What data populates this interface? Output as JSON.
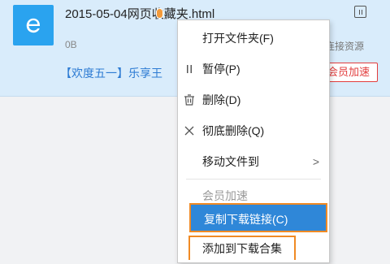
{
  "download": {
    "file_name": "2015-05-04网页收藏夹.html",
    "size": "0B",
    "connect_label": "连接资源",
    "promo_text": "【欢度五一】乐享王",
    "vip_button": "会员加速",
    "icon": "ie-e-icon",
    "accent_color": "#2aa3ef"
  },
  "menu": {
    "items": [
      {
        "label": "打开文件夹(F)",
        "icon": ""
      },
      {
        "label": "暂停(P)",
        "icon": "pause-icon"
      },
      {
        "label": "删除(D)",
        "icon": "trash-icon"
      },
      {
        "label": "彻底删除(Q)",
        "icon": "close-icon"
      },
      {
        "label": "移动文件到",
        "icon": "",
        "arrow": ">"
      },
      {
        "label": "会员加速",
        "disabled": true
      },
      {
        "label": "复制下载链接(C)",
        "highlighted": true
      },
      {
        "label": "添加到下载合集"
      }
    ],
    "highlight_color": "#2f87d8",
    "outline_color": "#f08a24"
  }
}
